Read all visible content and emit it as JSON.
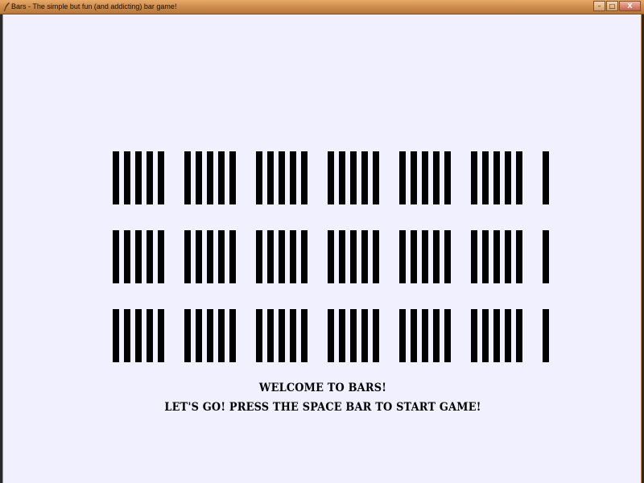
{
  "window": {
    "title": "Bars - The simple but fun (and addicting) bar game!",
    "controls": {
      "minimize": "–",
      "maximize": "□",
      "close": "X"
    }
  },
  "game": {
    "welcome": "WELCOME TO BARS!",
    "instruction": "LET'S GO! PRESS THE SPACE BAR TO START GAME!",
    "rows": 3,
    "bars_per_row": 31,
    "group_size": 5,
    "bar_color": "#000000",
    "background_color": "#f0f0fe"
  }
}
